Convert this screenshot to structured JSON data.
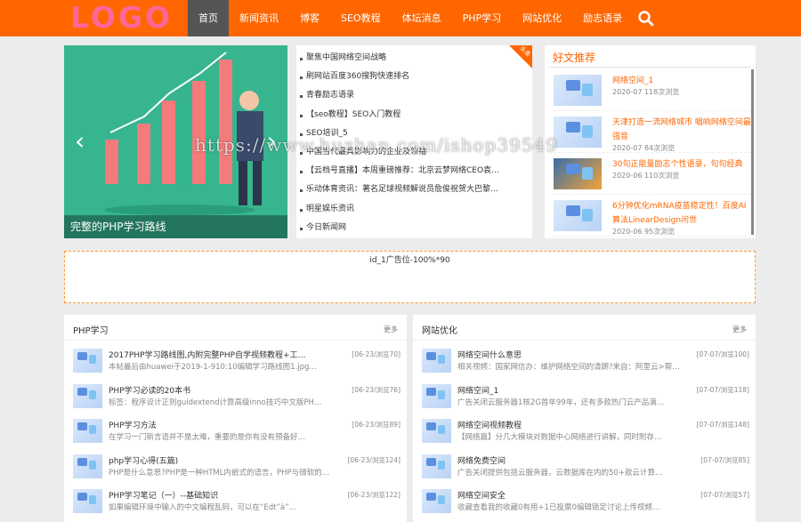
{
  "logo": "LOGO",
  "nav": [
    "首页",
    "新闻资讯",
    "博客",
    "SEO教程",
    "体坛消息",
    "PHP学习",
    "网站优化",
    "励志语录"
  ],
  "slider": {
    "caption": "完整的PHP学习路线"
  },
  "news": {
    "corner_badge": "头条",
    "items": [
      "聚焦中国网络空间战略",
      "刷网站百度360搜狗快速排名",
      "青春励志语录",
      "【seo教程】SEO入门教程",
      "SEO培训_5",
      "中国当代最具影响力的企业及领袖",
      "【云档号直播】本周重磅推荐：北京云梦网络CEO袁…",
      "乐动体育资讯：著名足球视频解说员詹俊祝贺大巴黎…",
      "明星娱乐资讯",
      "今日新闻网"
    ]
  },
  "hot": {
    "title": "好文推荐",
    "items": [
      {
        "name": "网络空间_1",
        "meta": "2020-07  118次浏览"
      },
      {
        "name": "天津打造一流网络城市 唱响网络空间最强音",
        "meta": "2020-07  84次浏览"
      },
      {
        "name": "30句正能量励志个性语录，句句经典",
        "meta": "2020-06  110次浏览"
      },
      {
        "name": "6分钟优化mRNA疫苗稳定性！百度AI算法LinearDesign问世",
        "meta": "2020-06  95次浏览"
      }
    ]
  },
  "ad": {
    "text": "id_1广告位-100%*90"
  },
  "php": {
    "title": "PHP学习",
    "more": "更多",
    "items": [
      {
        "title": "2017PHP学习路线图,内附完整PHP自学视频教程+工…",
        "summary": "本帖最后由huawei于2019-1-910:10编辑学习路线图1.jpg…",
        "date": "[06-23/浏览70]"
      },
      {
        "title": "PHP学习必读的20本书",
        "summary": "标签：程序设计正则guidextend计算高级inno技巧中文版PH…",
        "date": "[06-23/浏览76]"
      },
      {
        "title": "PHP学习方法",
        "summary": "在学习一门新言语并不是太难，重要的是你有没有预备好…",
        "date": "[06-23/浏览89]"
      },
      {
        "title": "php学习心得(五篇)",
        "summary": "PHP是什么意思?PHP是一种HTML内嵌式的语言，PHP与微软的…",
        "date": "[06-23/浏览124]"
      },
      {
        "title": "PHP学习笔记（一）--基础知识",
        "summary": "如果编辑环境中输入的中文编程乱码，可以在“Edt”à”…",
        "date": "[06-23/浏览122]"
      }
    ]
  },
  "seo": {
    "title": "网站优化",
    "more": "更多",
    "items": [
      {
        "title": "网络空间什么意思",
        "summary": "相关视频：国家网信办：维护网络空间的清朗?来自：阿里云>帮…",
        "date": "[07-07/浏览100]"
      },
      {
        "title": "网络空间_1",
        "summary": "广告关闭云服务器1核2G首年99年，还有多款热门云产品满…",
        "date": "[07-07/浏览118]"
      },
      {
        "title": "网络空间视频教程",
        "summary": "【网络篇】分几大模块对数据中心网络进行讲解，同时附存…",
        "date": "[07-07/浏览148]"
      },
      {
        "title": "网络免费空间",
        "summary": "广告关闭提供包括云服务器，云数据库在内的50+款云计算…",
        "date": "[07-07/浏览85]"
      },
      {
        "title": "网络空间安全",
        "summary": "收藏查看我的收藏0有用+1已投票0编辑锁定讨论上传视频…",
        "date": "[07-07/浏览57]"
      }
    ]
  },
  "watermark": "https://www.huzhan.com/ishop39549"
}
